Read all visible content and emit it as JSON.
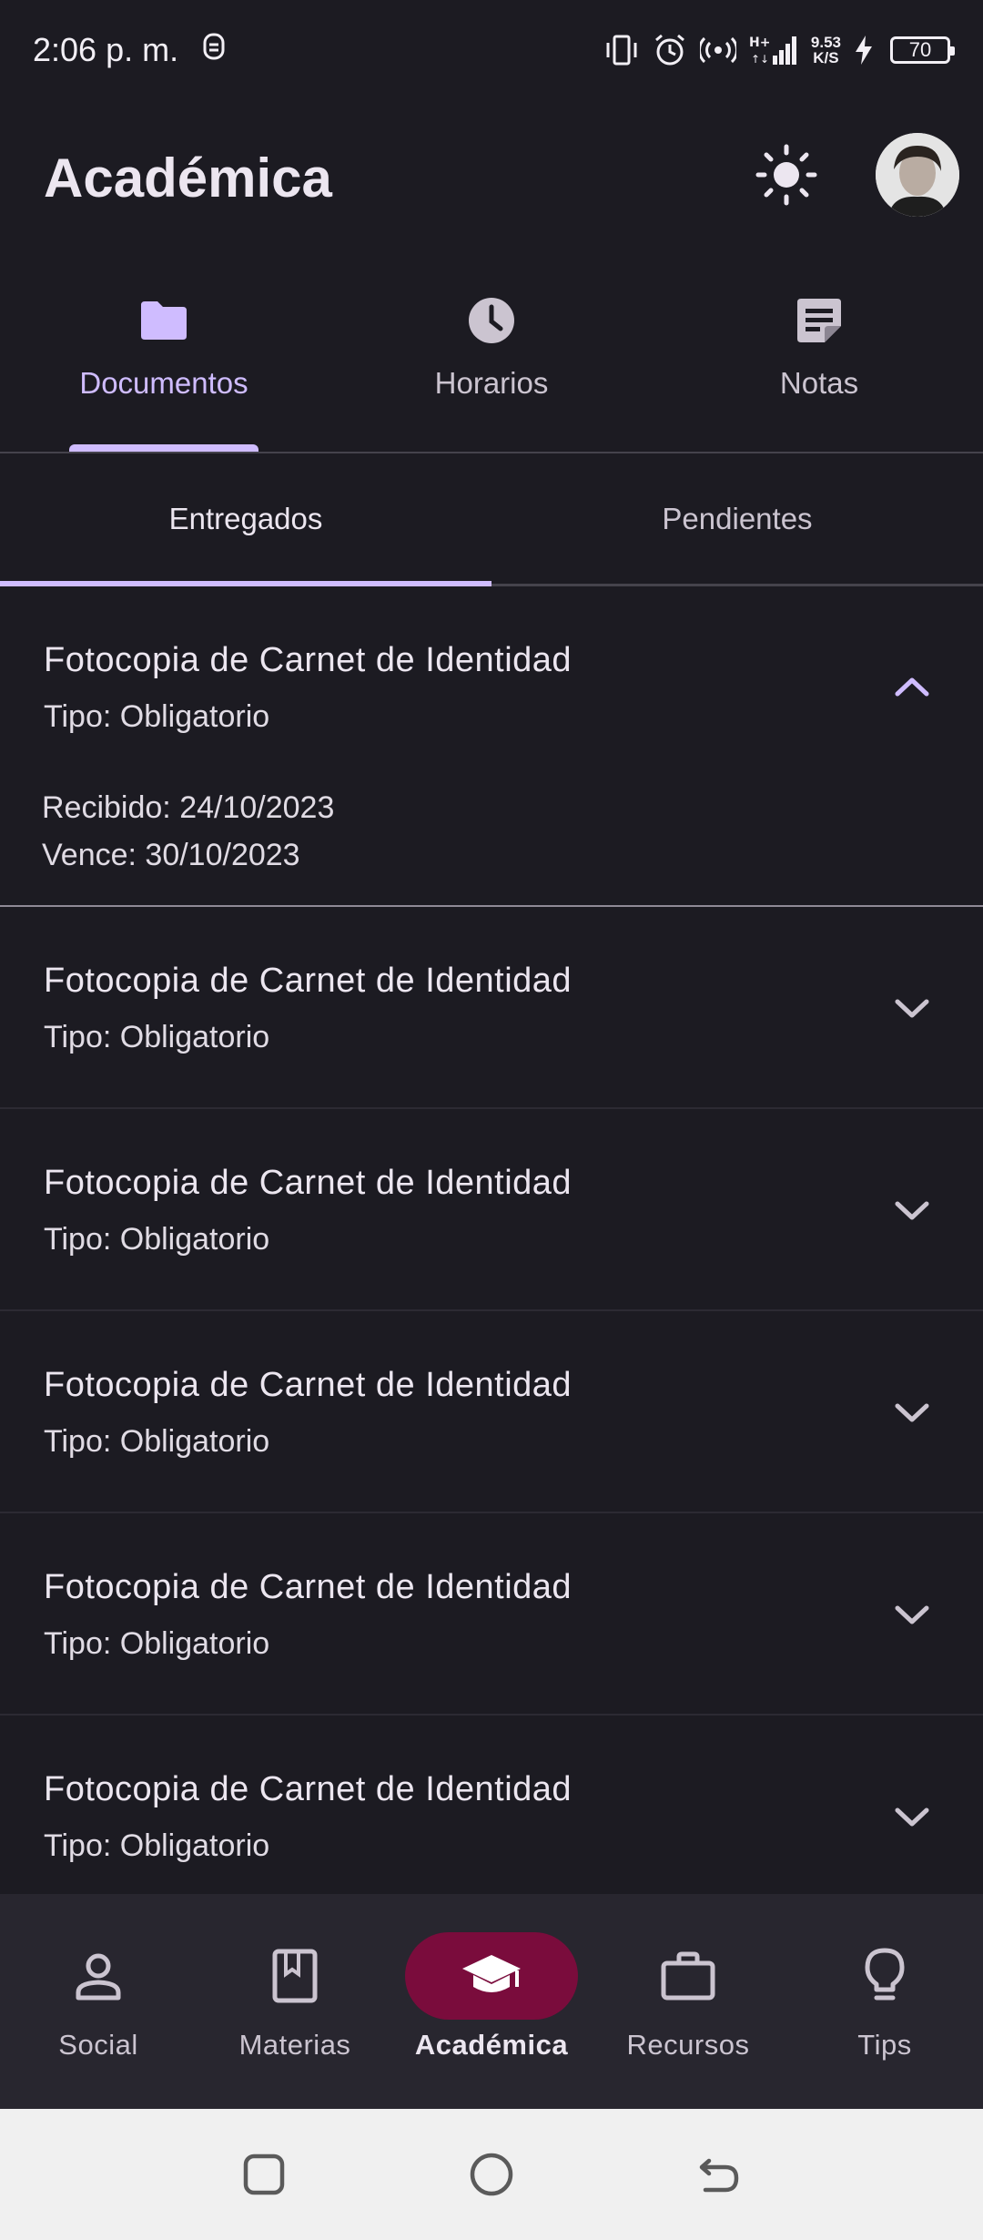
{
  "status_bar": {
    "time": "2:06 p. m.",
    "speed_value": "9.53",
    "speed_unit": "K/S",
    "network": "H+",
    "battery": "70"
  },
  "header": {
    "title": "Académica"
  },
  "main_tabs": [
    {
      "label": "Documentos",
      "icon": "folder-icon",
      "active": true
    },
    {
      "label": "Horarios",
      "icon": "clock-icon",
      "active": false
    },
    {
      "label": "Notas",
      "icon": "note-icon",
      "active": false
    }
  ],
  "sub_tabs": [
    {
      "label": "Entregados",
      "active": true
    },
    {
      "label": "Pendientes",
      "active": false
    }
  ],
  "documents": [
    {
      "title": "Fotocopia de Carnet de Identidad",
      "type": "Tipo: Obligatorio",
      "expanded": true,
      "received": "Recibido: 24/10/2023",
      "due": "Vence: 30/10/2023"
    },
    {
      "title": "Fotocopia de Carnet de Identidad",
      "type": "Tipo: Obligatorio",
      "expanded": false
    },
    {
      "title": "Fotocopia de Carnet de Identidad",
      "type": "Tipo: Obligatorio",
      "expanded": false
    },
    {
      "title": "Fotocopia de Carnet de Identidad",
      "type": "Tipo: Obligatorio",
      "expanded": false
    },
    {
      "title": "Fotocopia de Carnet de Identidad",
      "type": "Tipo: Obligatorio",
      "expanded": false
    },
    {
      "title": "Fotocopia de Carnet de Identidad",
      "type": "Tipo: Obligatorio",
      "expanded": false
    }
  ],
  "bottom_nav": [
    {
      "label": "Social",
      "icon": "person-icon",
      "active": false
    },
    {
      "label": "Materias",
      "icon": "book-icon",
      "active": false
    },
    {
      "label": "Académica",
      "icon": "graduation-cap-icon",
      "active": true
    },
    {
      "label": "Recursos",
      "icon": "briefcase-icon",
      "active": false
    },
    {
      "label": "Tips",
      "icon": "lightbulb-icon",
      "active": false
    }
  ],
  "colors": {
    "background": "#1c1b22",
    "accent": "#cfbcff",
    "active_nav_pill": "#7a0c3c",
    "nav_background": "#28262f"
  }
}
